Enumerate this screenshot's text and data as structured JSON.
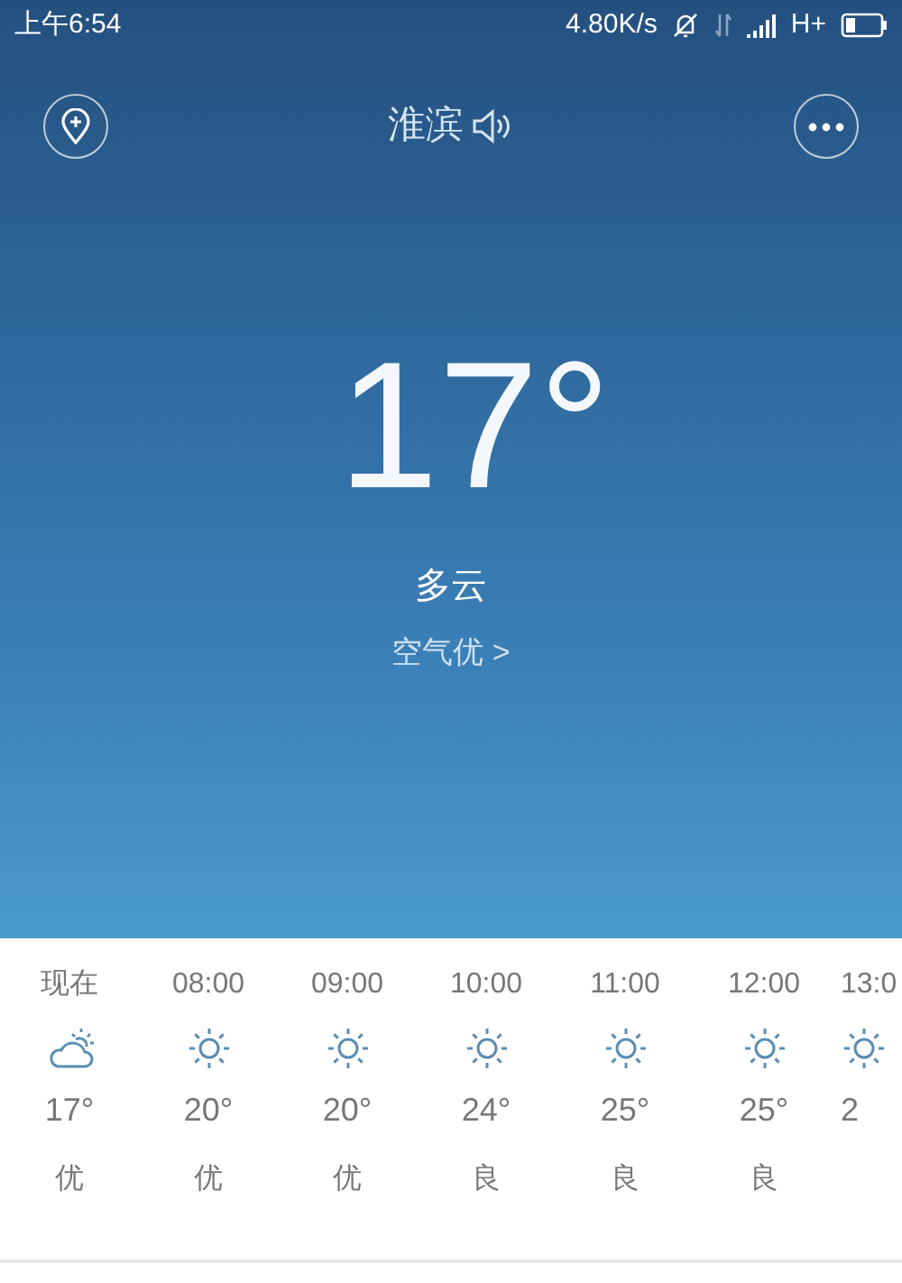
{
  "status_bar": {
    "time": "上午6:54",
    "speed": "4.80K/s",
    "network": "H+"
  },
  "header": {
    "city": "淮滨"
  },
  "current": {
    "temperature": "17°",
    "condition": "多云",
    "air_quality": "空气优 >"
  },
  "hourly": [
    {
      "time": "现在",
      "kind": "cloudy-sun",
      "temperature": "17°",
      "quality": "优"
    },
    {
      "time": "08:00",
      "kind": "sun",
      "temperature": "20°",
      "quality": "优"
    },
    {
      "time": "09:00",
      "kind": "sun",
      "temperature": "20°",
      "quality": "优"
    },
    {
      "time": "10:00",
      "kind": "sun",
      "temperature": "24°",
      "quality": "良"
    },
    {
      "time": "11:00",
      "kind": "sun",
      "temperature": "25°",
      "quality": "良"
    },
    {
      "time": "12:00",
      "kind": "sun",
      "temperature": "25°",
      "quality": "良"
    },
    {
      "time": "13:0",
      "kind": "sun",
      "temperature": "2"
    }
  ]
}
